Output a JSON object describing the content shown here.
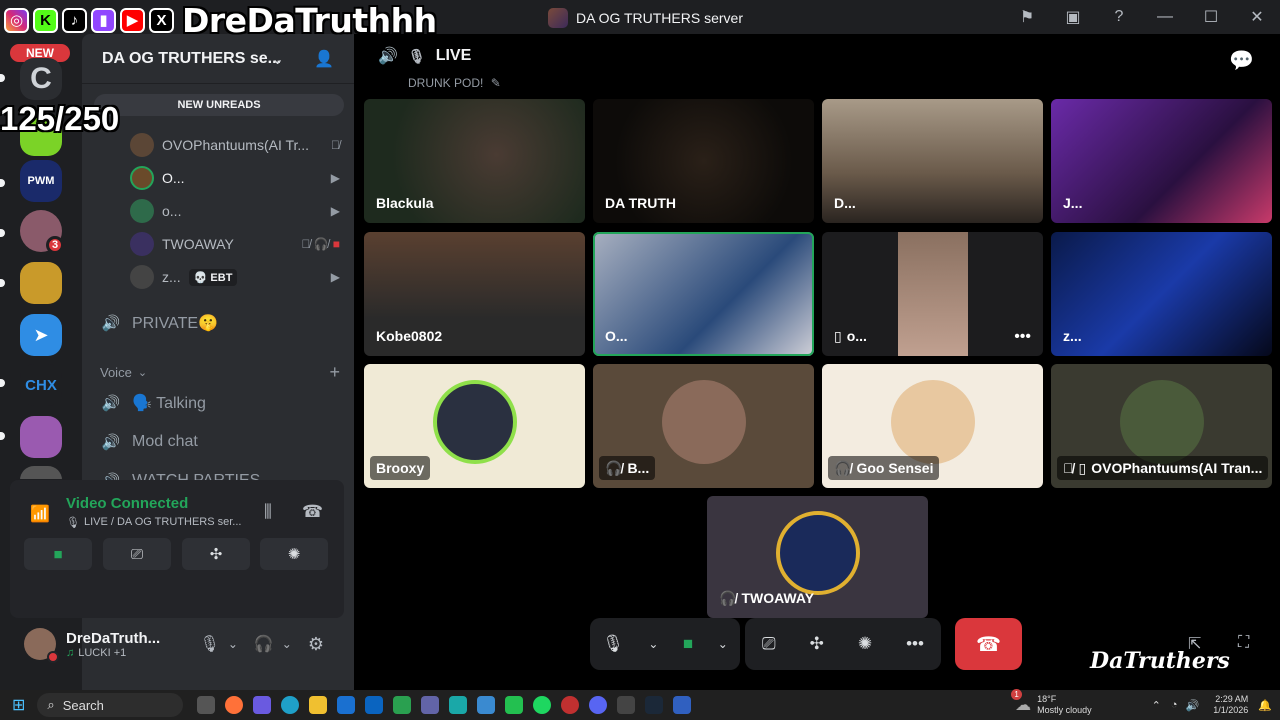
{
  "overlay": {
    "handle": "DreDaTruthhh",
    "counter": "125/250",
    "new_badge": "NEW"
  },
  "window": {
    "title": "DA OG TRUTHERS server"
  },
  "server": {
    "name": "DA OG TRUTHERS se...",
    "new_unreads": "NEW UNREADS"
  },
  "rail": {
    "mention_badge": "3",
    "chx": "CHX"
  },
  "voice_users": [
    {
      "name": "OVOPhantuums(AI Tr...",
      "color": "#5b4636"
    },
    {
      "name": "O...",
      "color": "#6a4a2a"
    },
    {
      "name": "o...",
      "color": "#2e6a4a"
    },
    {
      "name": "TWOAWAY",
      "color": "#3a3060"
    },
    {
      "name": "z...",
      "color": "#444",
      "tag": "💀 EBT"
    }
  ],
  "channels": {
    "private": "PRIVATE🤫",
    "voice_category": "Voice",
    "talking": "🗣️ Talking",
    "mod_chat": "Mod chat",
    "watch_parties": "WATCH PARTIES"
  },
  "voice_panel": {
    "status": "Video Connected",
    "location": "LIVE / DA OG TRUTHERS ser..."
  },
  "user": {
    "name": "DreDaTruth...",
    "status": "LUCKI +1"
  },
  "stage": {
    "channel": "LIVE",
    "topic": "DRUNK POD!"
  },
  "tiles": [
    {
      "label": "Blackula"
    },
    {
      "label": "DA TRUTH"
    },
    {
      "label": "D..."
    },
    {
      "label": "J..."
    },
    {
      "label": "Kobe0802"
    },
    {
      "label": "O..."
    },
    {
      "label": "o..."
    },
    {
      "label": "z..."
    },
    {
      "label": "Brooxy"
    },
    {
      "label": "B..."
    },
    {
      "label": "Goo Sensei"
    },
    {
      "label": "OVOPhantuums(AI Tran..."
    },
    {
      "label": "TWOAWAY"
    }
  ],
  "taskbar": {
    "search": "Search",
    "weather_temp": "18°F",
    "weather_desc": "Mostly cloudy",
    "time": "2:29 AM",
    "date": "1/1/2026",
    "weather_badge": "1"
  },
  "colors": {
    "accent_green": "#23a55a",
    "danger": "#da373c"
  },
  "watermark": "DaTruthers"
}
